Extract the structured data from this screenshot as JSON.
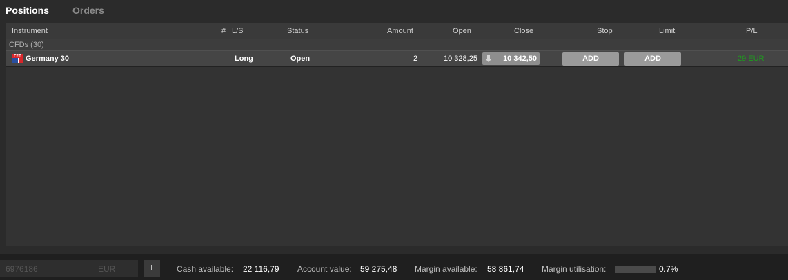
{
  "tabs": [
    {
      "label": "Positions",
      "active": true
    },
    {
      "label": "Orders",
      "active": false
    }
  ],
  "table": {
    "columns": [
      "Instrument",
      "#",
      "L/S",
      "Status",
      "Amount",
      "Open",
      "Close",
      "Stop",
      "Limit",
      "P/L"
    ],
    "group_label": "CFDs (30)",
    "row": {
      "instrument": "Germany 30",
      "icon": "cfd-flag-icon",
      "direction": "Long",
      "status": "Open",
      "amount": "2",
      "open": "10 328,25",
      "close": "10 342,50",
      "stop_button": "ADD",
      "limit_button": "ADD",
      "pl": "29 EUR"
    }
  },
  "footer": {
    "account_number": "6976186",
    "currency": "EUR",
    "info_label": "i",
    "cash_available_label": "Cash available:",
    "cash_available_value": "22 116,79",
    "account_value_label": "Account value:",
    "account_value_value": "59 275,48",
    "margin_available_label": "Margin available:",
    "margin_available_value": "58 861,74",
    "margin_utilisation_label": "Margin utilisation:",
    "margin_utilisation_value": "0.7%",
    "margin_utilisation_fraction": 0.007
  },
  "colors": {
    "background": "#2b2b2b",
    "panel": "#333333",
    "row_highlight": "#454545",
    "button_gray": "#9a9a9a",
    "profit_green": "#1f9a1f",
    "cfd_red": "#d8262b",
    "cfd_blue": "#2a4fa0"
  }
}
